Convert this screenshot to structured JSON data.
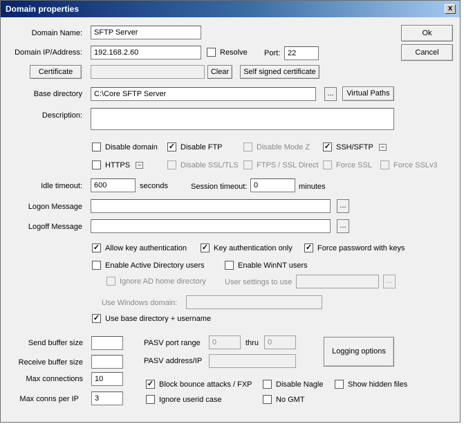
{
  "window": {
    "title": "Domain properties",
    "close_glyph": "x"
  },
  "buttons": {
    "ok": "Ok",
    "cancel": "Cancel",
    "certificate": "Certificate",
    "clear": "Clear",
    "self_signed": "Self signed certificate",
    "virtual_paths": "Virtual Paths",
    "logging_options": "Logging options",
    "ellipsis": "..."
  },
  "fields": {
    "domain_name": {
      "label": "Domain Name:",
      "value": "SFTP Server"
    },
    "domain_ip": {
      "label": "Domain IP/Address:",
      "value": "192.168.2.60"
    },
    "resolve": {
      "label": "Resolve",
      "checked": false
    },
    "port": {
      "label": "Port:",
      "value": "22"
    },
    "certificate_path": {
      "value": ""
    },
    "base_directory": {
      "label": "Base directory",
      "value": "C:\\Core SFTP Server"
    },
    "description": {
      "label": "Description:",
      "value": ""
    },
    "idle_timeout": {
      "label": "Idle timeout:",
      "value": "600",
      "unit": "seconds"
    },
    "session_timeout": {
      "label": "Session timeout:",
      "value": "0",
      "unit": "minutes"
    },
    "logon_message": {
      "label": "Logon Message",
      "value": ""
    },
    "logoff_message": {
      "label": "Logoff Message",
      "value": ""
    },
    "user_settings": {
      "label": "User settings to use",
      "value": ""
    },
    "windows_domain": {
      "label": "Use Windows domain:",
      "value": ""
    },
    "send_buffer": {
      "label": "Send buffer size",
      "value": ""
    },
    "receive_buffer": {
      "label": "Receive buffer size",
      "value": ""
    },
    "max_connections": {
      "label": "Max connections",
      "value": "10"
    },
    "max_conns_per_ip": {
      "label": "Max conns per IP",
      "value": "3"
    },
    "pasv_port_range": {
      "label": "PASV port range",
      "from": "0",
      "thru_label": "thru",
      "to": "0"
    },
    "pasv_address": {
      "label": "PASV address/IP",
      "value": ""
    }
  },
  "checkboxes": {
    "disable_domain": {
      "label": "Disable domain",
      "checked": false,
      "enabled": true
    },
    "disable_ftp": {
      "label": "Disable FTP",
      "checked": true,
      "enabled": true
    },
    "disable_mode_z": {
      "label": "Disable Mode Z",
      "checked": false,
      "enabled": false
    },
    "ssh_sftp": {
      "label": "SSH/SFTP",
      "checked": true,
      "enabled": true
    },
    "https": {
      "label": "HTTPS",
      "checked": false,
      "enabled": true
    },
    "disable_ssl_tls": {
      "label": "Disable SSL/TLS",
      "checked": false,
      "enabled": false
    },
    "ftps_ssl_direct": {
      "label": "FTPS / SSL Direct",
      "checked": false,
      "enabled": false
    },
    "force_ssl": {
      "label": "Force SSL",
      "checked": false,
      "enabled": false
    },
    "force_sslv3": {
      "label": "Force SSLv3",
      "checked": false,
      "enabled": false
    },
    "allow_key_auth": {
      "label": "Allow key authentication",
      "checked": true,
      "enabled": true
    },
    "key_auth_only": {
      "label": "Key authentication only",
      "checked": true,
      "enabled": true
    },
    "force_password_keys": {
      "label": "Force password with keys",
      "checked": true,
      "enabled": true
    },
    "enable_ad_users": {
      "label": "Enable Active Directory users",
      "checked": false,
      "enabled": true
    },
    "enable_winnt_users": {
      "label": "Enable WinNT users",
      "checked": false,
      "enabled": true
    },
    "ignore_ad_home": {
      "label": "Ignore AD home directory",
      "checked": false,
      "enabled": false
    },
    "use_base_dir_username": {
      "label": "Use base directory + username",
      "checked": true,
      "enabled": true
    },
    "block_bounce": {
      "label": "Block bounce attacks / FXP",
      "checked": true,
      "enabled": true
    },
    "disable_nagle": {
      "label": "Disable Nagle",
      "checked": false,
      "enabled": true
    },
    "show_hidden": {
      "label": "Show hidden files",
      "checked": false,
      "enabled": true
    },
    "ignore_userid_case": {
      "label": "Ignore userid case",
      "checked": false,
      "enabled": true
    },
    "no_gmt": {
      "label": "No GMT",
      "checked": false,
      "enabled": true
    }
  },
  "glyphs": {
    "check": "✓",
    "mini": "–"
  }
}
